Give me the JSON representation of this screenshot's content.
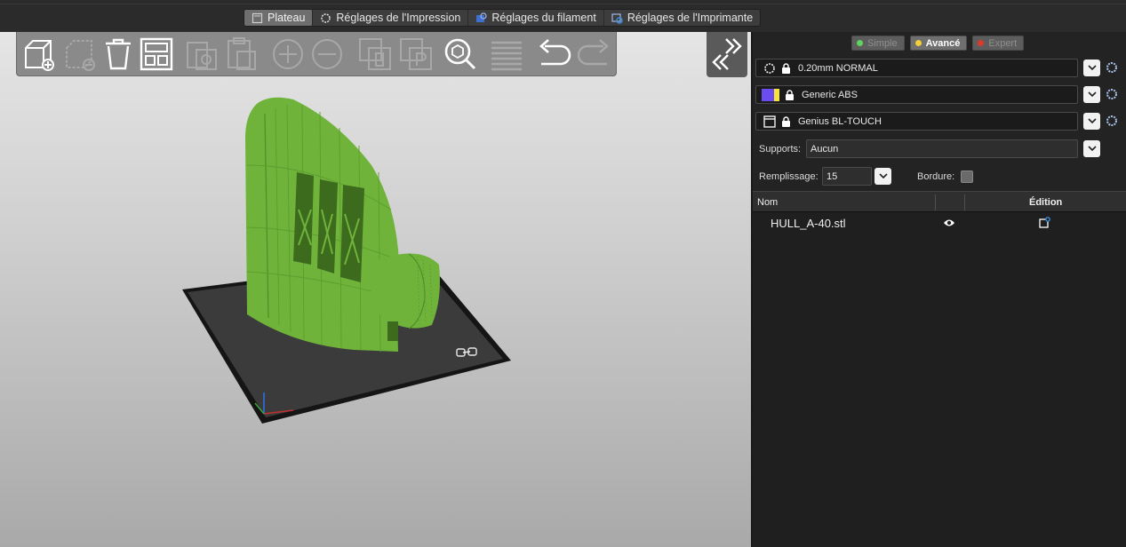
{
  "tabs": [
    {
      "label": "Plateau",
      "icon": "plate-icon",
      "active": true
    },
    {
      "label": "Réglages de l'Impression",
      "icon": "print-settings-icon",
      "active": false
    },
    {
      "label": "Réglages du filament",
      "icon": "filament-settings-icon",
      "active": false
    },
    {
      "label": "Réglages de l'Imprimante",
      "icon": "printer-settings-icon",
      "active": false
    }
  ],
  "toolbar": {
    "tools": [
      "add-object-icon",
      "delete-icon",
      "delete-all-icon",
      "arrange-icon",
      "copy-icon",
      "paste-icon",
      "add-instance-icon",
      "remove-instance-icon",
      "split-objects-icon",
      "split-parts-icon",
      "search-icon",
      "layers-icon",
      "undo-icon",
      "redo-icon"
    ]
  },
  "modes": [
    {
      "label": "Simple",
      "color": "#5fd35f",
      "active": false
    },
    {
      "label": "Avancé",
      "color": "#f2cf3a",
      "active": true
    },
    {
      "label": "Expert",
      "color": "#d93a2b",
      "active": false
    }
  ],
  "presets": {
    "print": "0.20mm NORMAL",
    "filament": "Generic ABS",
    "printer": "Genius BL-TOUCH"
  },
  "filament_colors": [
    "#6a4cf0",
    "#f5e23a"
  ],
  "settings": {
    "supports_label": "Supports:",
    "supports_value": "Aucun",
    "infill_label": "Remplissage:",
    "infill_value": "15",
    "brim_label": "Bordure:"
  },
  "objects": {
    "col_name": "Nom",
    "col_edit": "Édition",
    "rows": [
      {
        "name": "HULL_A-40.stl"
      }
    ]
  },
  "colors": {
    "model": "#6fb33a",
    "bed": "#3b3b3b",
    "accent": "#3c8fe0"
  }
}
